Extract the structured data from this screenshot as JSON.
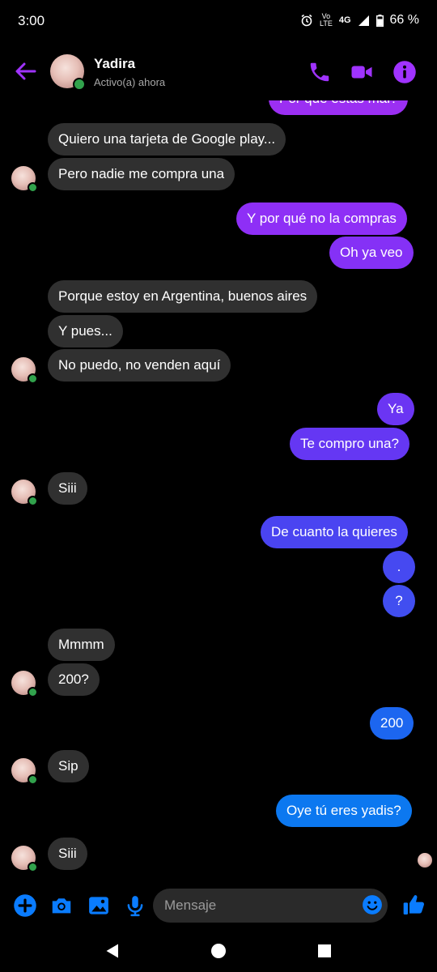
{
  "status_bar": {
    "time": "3:00",
    "network_top": "Vo",
    "network_bottom": "LTE",
    "network_type": "4G",
    "battery": "66 %"
  },
  "header": {
    "contact_name": "Yadira",
    "contact_status": "Activo(a) ahora"
  },
  "colors": {
    "accent": "#a033ff",
    "incoming": "#303030",
    "blue": "#0a7cff",
    "online": "#31a24c"
  },
  "messages": {
    "m0": "Por qué estás mal?",
    "m1": "Quiero una tarjeta de Google play...",
    "m2": "Pero nadie me compra una",
    "m3": "Y por qué no la compras",
    "m4": "Oh ya veo",
    "m5": "Porque estoy en Argentina, buenos aires",
    "m6": "Y pues...",
    "m7": "No puedo, no venden aquí",
    "m8": "Ya",
    "m9": "Te compro una?",
    "m10": "Siii",
    "m11": "De cuanto la quieres",
    "m12": ".",
    "m13": "?",
    "m14": "Mmmm",
    "m15": "200?",
    "m16": "200",
    "m17": "Sip",
    "m18": "Oye tú eres yadis?",
    "m19": "Siii"
  },
  "composer": {
    "placeholder": "Mensaje"
  },
  "icons": [
    "back-arrow-icon",
    "phone-icon",
    "video-icon",
    "info-icon",
    "plus-icon",
    "camera-icon",
    "image-icon",
    "mic-icon",
    "emoji-icon",
    "like-icon"
  ]
}
